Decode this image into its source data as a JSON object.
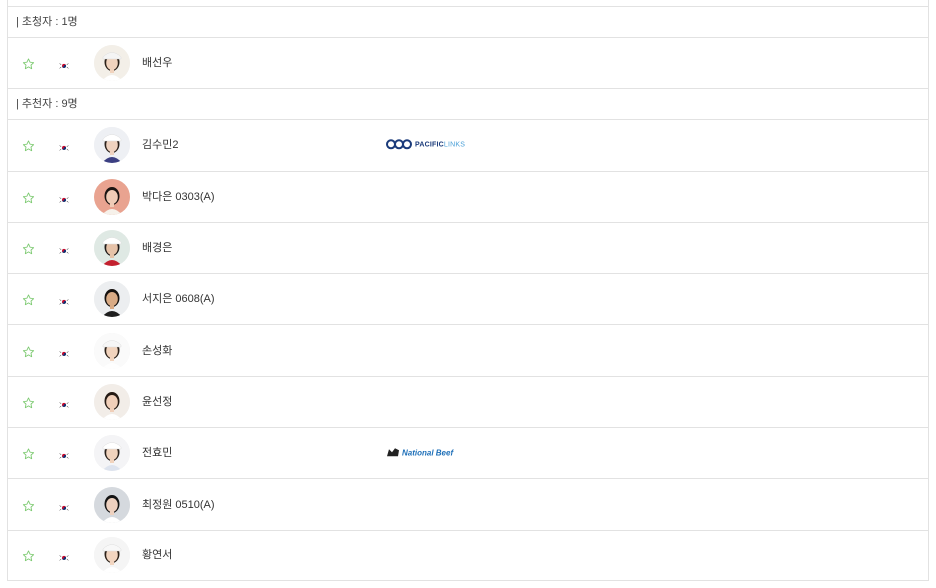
{
  "sections": [
    {
      "header": "| 초청자 : 1명",
      "players": [
        {
          "name": "배선우",
          "sponsor": "",
          "avatar": {
            "bg": "#f3efe8",
            "skin": "#f1d3bd",
            "hair": "#2b2119",
            "shirt": "#ffffff",
            "cap": "#f4f4f4"
          }
        }
      ]
    },
    {
      "header": "| 추천자 : 9명",
      "players": [
        {
          "name": "김수민2",
          "sponsor": "PACIFIC LINKS",
          "avatar": {
            "bg": "#eef0f4",
            "skin": "#efd2bf",
            "hair": "#2a211b",
            "shirt": "#3b3f82",
            "cap": "#ffffff"
          }
        },
        {
          "name": "박다은 0303(A)",
          "sponsor": "",
          "avatar": {
            "bg": "#e9a390",
            "skin": "#f0cbb6",
            "hair": "#1b1412",
            "shirt": "#f6f1ea",
            "cap": ""
          }
        },
        {
          "name": "배경은",
          "sponsor": "",
          "avatar": {
            "bg": "#dfe9e4",
            "skin": "#e6c2a8",
            "hair": "#1f1a18",
            "shirt": "#c3202e",
            "cap": "#ffffff"
          }
        },
        {
          "name": "서지은 0608(A)",
          "sponsor": "",
          "avatar": {
            "bg": "#eceef0",
            "skin": "#d9ab85",
            "hair": "#16120f",
            "shirt": "#1e1e1e",
            "cap": ""
          }
        },
        {
          "name": "손성화",
          "sponsor": "",
          "avatar": {
            "bg": "#fafafa",
            "skin": "#f1d3bd",
            "hair": "#2b2119",
            "shirt": "#fefefe",
            "cap": "#f6f6f6"
          }
        },
        {
          "name": "윤선정",
          "sponsor": "",
          "avatar": {
            "bg": "#f2ede8",
            "skin": "#f0cfb9",
            "hair": "#241a14",
            "shirt": "#ffffff",
            "cap": ""
          }
        },
        {
          "name": "전효민",
          "sponsor": "National Beef",
          "avatar": {
            "bg": "#f4f4f6",
            "skin": "#f1d3bd",
            "hair": "#2a211b",
            "shirt": "#dde3ee",
            "cap": "#ffffff"
          }
        },
        {
          "name": "최정원 0510(A)",
          "sponsor": "",
          "avatar": {
            "bg": "#d5d9de",
            "skin": "#eed1bf",
            "hair": "#141414",
            "shirt": "#ffffff",
            "cap": ""
          }
        },
        {
          "name": "황연서",
          "sponsor": "",
          "avatar": {
            "bg": "#f5f5f5",
            "skin": "#f2d5c0",
            "hair": "#2b2119",
            "shirt": "#ffffff",
            "cap": "#f8f8f8"
          }
        }
      ]
    }
  ],
  "icons": {
    "star": "star-outline-icon",
    "flag": "korea-flag-icon"
  },
  "colors": {
    "star": "#7bc96f",
    "border": "#e2e2e2",
    "pacific_dark": "#1a3a7a",
    "pacific_light": "#4aa0d8",
    "national_beef": "#1d6fb8"
  }
}
